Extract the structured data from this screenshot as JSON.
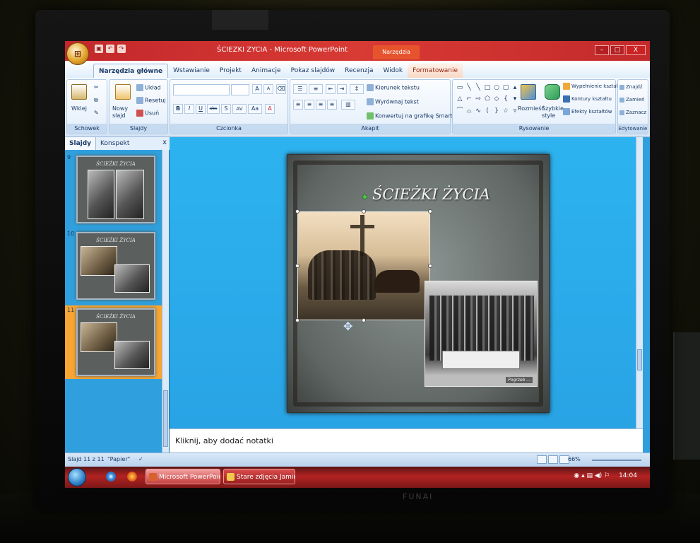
{
  "window": {
    "title": "ŚCIEZKI ZYCIA - Microsoft PowerPoint",
    "context_tab_group": "Narzędzia obrazów",
    "office_button_icon": "office-logo-icon",
    "qat_icons": [
      "save-icon",
      "undo-icon",
      "redo-icon"
    ]
  },
  "ribbon": {
    "tabs": [
      "Narzędzia główne",
      "Wstawianie",
      "Projekt",
      "Animacje",
      "Pokaz slajdów",
      "Recenzja",
      "Widok",
      "Formatowanie"
    ],
    "active_tab": "Narzędzia główne",
    "groups": {
      "clipboard": {
        "label": "Schowek",
        "paste": "Wklej"
      },
      "slides": {
        "label": "Slajdy",
        "new_slide": "Nowy slajd",
        "layout": "Układ",
        "reset": "Resetuj",
        "delete": "Usuń"
      },
      "font": {
        "label": "Czcionka",
        "bold": "B",
        "italic": "I",
        "underline": "U",
        "strike": "abc",
        "shadow": "S",
        "spacing": "AV",
        "case": "Aa",
        "color": "A",
        "grow": "A",
        "shrink": "A"
      },
      "paragraph": {
        "label": "Akapit",
        "text_direction": "Kierunek tekstu",
        "align_text": "Wyrównaj tekst",
        "smartart": "Konwertuj na grafikę SmartArt"
      },
      "drawing": {
        "label": "Rysowanie",
        "arrange": "Rozmieść",
        "quick_styles": "Szybkie style",
        "fill": "Wypełnienie kształtu",
        "outline": "Kontury kształtu",
        "effects": "Efekty kształtów"
      },
      "editing": {
        "label": "Edytowanie",
        "find": "Znajdź",
        "replace": "Zamień",
        "select": "Zaznacz"
      }
    }
  },
  "slides_pane": {
    "tabs": [
      "Slajdy",
      "Konspekt"
    ],
    "close": "x",
    "thumbnails": [
      {
        "number": "9",
        "title": "ŚCIEŻKI ŻYCIA"
      },
      {
        "number": "10",
        "title": "ŚCIEŻKI ŻYCIA"
      },
      {
        "number": "11",
        "title": "ŚCIEŻKI ŻYCIA",
        "selected": true
      }
    ]
  },
  "slide": {
    "title": "ŚCIEŻKI ŻYCIA",
    "photo_caption": "Pogrzeb ..."
  },
  "notes": {
    "placeholder": "Kliknij, aby dodać notatki"
  },
  "status_bar": {
    "slide_counter": "Slajd 11 z 11",
    "theme": "\"Papier\"",
    "zoom": "66%"
  },
  "taskbar": {
    "buttons": [
      "Microsoft PowerPoin...",
      "Stare zdjęcia Jaminy"
    ],
    "clock": "14:04"
  },
  "monitor": {
    "brand": "FUNAI"
  },
  "colors": {
    "titlebar": "#c82a2c",
    "ribbon": "#e4eefa",
    "stage": "#2db3f0",
    "taskbar": "#b32222",
    "selected_thumb": "#f7a634"
  }
}
